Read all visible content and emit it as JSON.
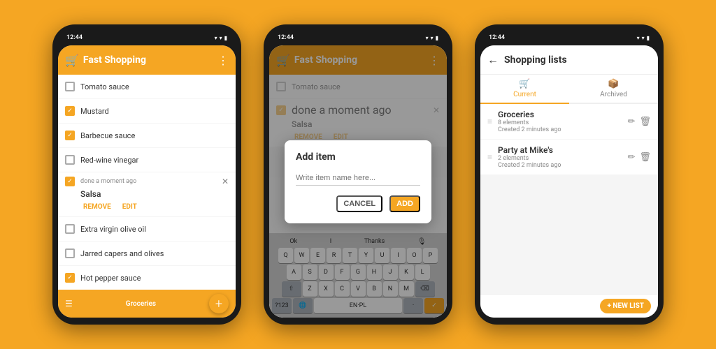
{
  "bg_color": "#F5A623",
  "phone1": {
    "time": "12:44",
    "app_title": "Fast Shopping",
    "items": [
      {
        "label": "Tomato sauce",
        "checked": false
      },
      {
        "label": "Mustard",
        "checked": true
      },
      {
        "label": "Barbecue sauce",
        "checked": true
      },
      {
        "label": "Red-wine vinegar",
        "checked": false
      }
    ],
    "expanded_item": {
      "time_tag": "done a moment ago",
      "name": "Salsa",
      "remove_label": "REMOVE",
      "edit_label": "EDIT"
    },
    "more_items": [
      {
        "label": "Extra virgin olive oil",
        "checked": false
      },
      {
        "label": "Jarred capers and olives",
        "checked": false
      },
      {
        "label": "Hot pepper sauce",
        "checked": true
      }
    ],
    "bottom_label": "Groceries",
    "fab_label": "+"
  },
  "phone2": {
    "time": "12:44",
    "app_title": "Fast Shopping",
    "dialog": {
      "title": "Add item",
      "placeholder": "Write item name here...",
      "cancel_label": "CANCEL",
      "add_label": "ADD"
    },
    "keyboard": {
      "suggestions": [
        "Ok",
        "I",
        "Thanks"
      ],
      "rows": [
        [
          "Q",
          "W",
          "E",
          "R",
          "T",
          "Y",
          "U",
          "I",
          "O",
          "P"
        ],
        [
          "A",
          "S",
          "D",
          "F",
          "G",
          "H",
          "J",
          "K",
          "L"
        ],
        [
          "⇧",
          "Z",
          "X",
          "C",
          "V",
          "B",
          "N",
          "M",
          "⌫"
        ],
        [
          "?123",
          "🌐",
          "EN·PL",
          "·",
          "✓"
        ]
      ]
    }
  },
  "phone3": {
    "time": "12:44",
    "screen_title": "Shopping lists",
    "tabs": [
      {
        "label": "Current",
        "active": true,
        "icon": "🛒"
      },
      {
        "label": "Archived",
        "active": false,
        "icon": "📦"
      }
    ],
    "lists": [
      {
        "title": "Groceries",
        "elements": "8 elements",
        "created": "Created 2 minutes ago"
      },
      {
        "title": "Party at Mike's",
        "elements": "2 elements",
        "created": "Created 2 minutes ago"
      }
    ],
    "new_list_label": "+ NEW LIST"
  }
}
